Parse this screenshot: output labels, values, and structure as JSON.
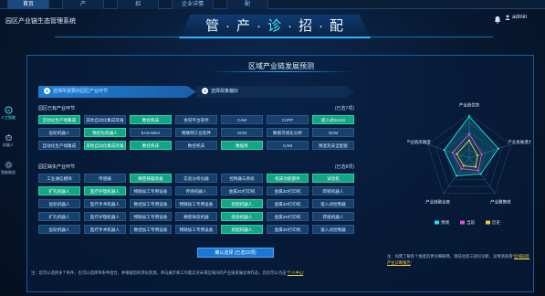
{
  "nav": {
    "tabs": [
      "首页",
      "产",
      "招",
      "企业详情",
      "配"
    ],
    "active": 0
  },
  "header": {
    "system_title": "园区产业链生态管理系统",
    "main_title": [
      "管",
      "·",
      "产",
      "·",
      "诊",
      "·",
      "招",
      "·",
      "配"
    ],
    "user": "admin"
  },
  "sidebar": {
    "items": [
      {
        "label": "人工智能",
        "active": true
      },
      {
        "label": "机器人",
        "active": false
      },
      {
        "label": "智能制造",
        "active": false
      }
    ]
  },
  "panel": {
    "title": "区域产业链发展预测",
    "steps": [
      {
        "num": "1",
        "label": "选择所需要的园区产业环节"
      },
      {
        "num": "2",
        "label": "选择政策偏好"
      }
    ],
    "existing": {
      "label": "园区已有产业环节",
      "count": "(已选7项)"
    },
    "existing_grid": [
      [
        "自动化生产线集成",
        "其他自动化集成装备",
        "数控机床",
        "协同平台软件",
        "CAM",
        "CAPP",
        "嵌入式SAAS"
      ],
      [
        "齿轮机器人",
        "数控化机器人",
        "EAS-MES",
        "物联网工业软件",
        "SCM",
        "数据可视化分析",
        "SCM"
      ],
      [
        "自动化生产线集成",
        "其他自动化集成装备",
        "数控机床",
        "数控机床",
        "数据库",
        "CAM",
        "预混及安全配套"
      ]
    ],
    "missing": {
      "label": "园区缺失产业环节",
      "count": "(已选8项)"
    },
    "missing_grid": [
      [
        "工业通信模块",
        "传感器",
        "精密铸锻装备",
        "实验分析仪器",
        "控制器与系统",
        "机床功能部件",
        "试验机"
      ],
      [
        "扩孔机器人",
        "医疗护理机器人",
        "物联加工专用设备",
        "传感机器人",
        "金属3D打印机",
        "金属3D打印机",
        "焊接机器人"
      ],
      [
        "齿轮机器人",
        "医疗手术机器人",
        "数控加工专用设备",
        "物联加工专用设备",
        "装配机器人",
        "金属3D打印机",
        "嵌入式控制器"
      ],
      [
        "扩孔机器人",
        "医疗护理机器人",
        "物联加工专用设备",
        "精密铸造机器",
        "喷涂机器人",
        "金属3D打印机",
        "焊接机器人"
      ],
      [
        "齿轮机器人",
        "医疗手术机器人",
        "数控加工专用设备",
        "物联加工专用设备",
        "装配机器人",
        "金属3D打印机",
        "嵌入式控制器"
      ]
    ],
    "confirm_label": "确认选择 (已选15项)",
    "note_left": "注：您可以选择多个条件，也可以选择单条件组合，并根据您的目标资源，单向展示和工作能实对未来区域内的产业链发展总体作态，您也可以点击“",
    "note_left_link": "个人中心",
    "note_right": "注：如需了解各个维度的更详细解释，请前往第三部份诊断，详情请查看“",
    "note_right_link": "区域园区产业诊断报告"
  },
  "chart_data": {
    "type": "radar",
    "axes": [
      "产业链优势",
      "产业发展潜力",
      "产业聚集度",
      "产业链融合度",
      "产业链高端度"
    ],
    "series": [
      {
        "name": "预测",
        "values": [
          0.95,
          0.7,
          0.45,
          0.5,
          0.6
        ]
      },
      {
        "name": "当前",
        "values": [
          0.55,
          0.3,
          0.35,
          0.3,
          0.4
        ]
      },
      {
        "name": "历史",
        "values": [
          0.4,
          0.2,
          0.25,
          0.22,
          0.3
        ]
      }
    ],
    "colors": [
      "#22e0ea",
      "#e24fd2",
      "#f3c842"
    ],
    "legend": "bottom"
  }
}
